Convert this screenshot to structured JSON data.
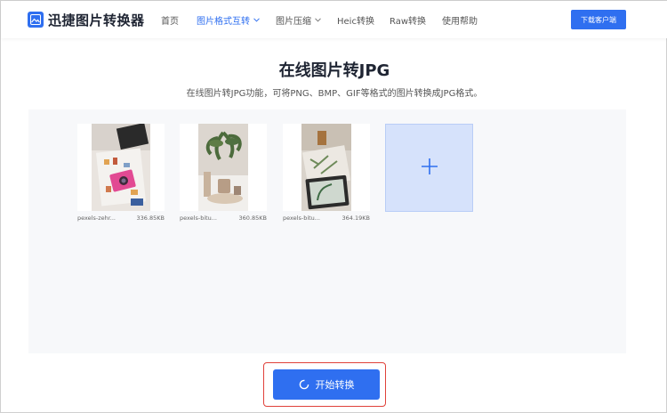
{
  "brand": {
    "name": "迅捷图片转换器",
    "accent": "#2f6ff0"
  },
  "nav": {
    "items": [
      {
        "label": "首页",
        "active": false,
        "dropdown": false
      },
      {
        "label": "图片格式互转",
        "active": true,
        "dropdown": true
      },
      {
        "label": "图片压缩",
        "active": false,
        "dropdown": true
      },
      {
        "label": "Heic转换",
        "active": false,
        "dropdown": false
      },
      {
        "label": "Raw转换",
        "active": false,
        "dropdown": false
      },
      {
        "label": "使用帮助",
        "active": false,
        "dropdown": false
      }
    ],
    "download_label": "下载客户端"
  },
  "main": {
    "title": "在线图片转JPG",
    "subtitle": "在线图片转JPG功能，可将PNG、BMP、GIF等格式的图片转换成JPG格式。"
  },
  "files": [
    {
      "name": "pexels-zehr...",
      "size": "336.85KB"
    },
    {
      "name": "pexels-bitu...",
      "size": "360.85KB"
    },
    {
      "name": "pexels-bitu...",
      "size": "364.19KB"
    }
  ],
  "add_icon": "plus-icon",
  "start_button": {
    "label": "开始转换",
    "icon": "loading-icon"
  }
}
